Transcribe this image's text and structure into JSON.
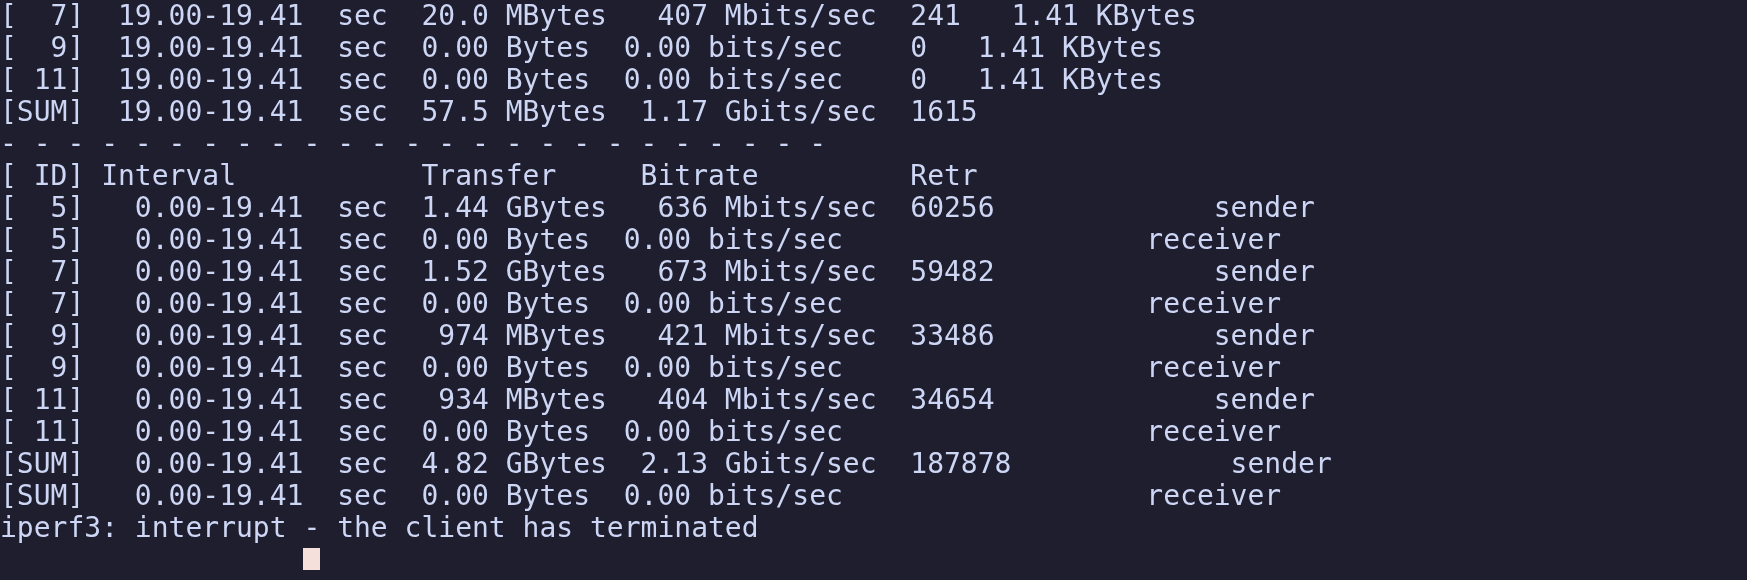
{
  "terminal": {
    "lines": [
      "[  7]  19.00-19.41  sec  20.0 MBytes   407 Mbits/sec  241   1.41 KBytes",
      "[  9]  19.00-19.41  sec  0.00 Bytes  0.00 bits/sec    0   1.41 KBytes",
      "[ 11]  19.00-19.41  sec  0.00 Bytes  0.00 bits/sec    0   1.41 KBytes",
      "[SUM]  19.00-19.41  sec  57.5 MBytes  1.17 Gbits/sec  1615",
      "- - - - - - - - - - - - - - - - - - - - - - - - -",
      "[ ID] Interval           Transfer     Bitrate         Retr",
      "[  5]   0.00-19.41  sec  1.44 GBytes   636 Mbits/sec  60256             sender",
      "[  5]   0.00-19.41  sec  0.00 Bytes  0.00 bits/sec                  receiver",
      "[  7]   0.00-19.41  sec  1.52 GBytes   673 Mbits/sec  59482             sender",
      "[  7]   0.00-19.41  sec  0.00 Bytes  0.00 bits/sec                  receiver",
      "[  9]   0.00-19.41  sec   974 MBytes   421 Mbits/sec  33486             sender",
      "[  9]   0.00-19.41  sec  0.00 Bytes  0.00 bits/sec                  receiver",
      "[ 11]   0.00-19.41  sec   934 MBytes   404 Mbits/sec  34654             sender",
      "[ 11]   0.00-19.41  sec  0.00 Bytes  0.00 bits/sec                  receiver",
      "[SUM]   0.00-19.41  sec  4.82 GBytes  2.13 Gbits/sec  187878             sender",
      "[SUM]   0.00-19.41  sec  0.00 Bytes  0.00 bits/sec                  receiver",
      "iperf3: interrupt - the client has terminated"
    ],
    "cursor_visible": true
  }
}
